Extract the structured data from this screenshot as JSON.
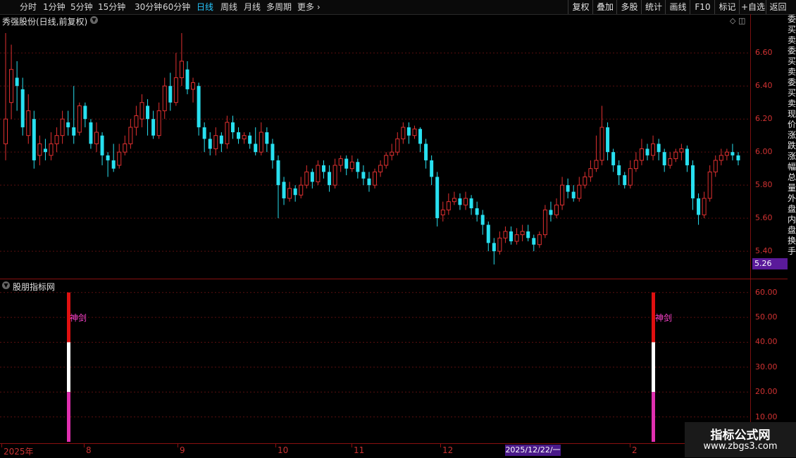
{
  "toolbar": {
    "periods": [
      "分时",
      "1分钟",
      "5分钟",
      "15分钟",
      "30分钟",
      "60分钟",
      "日线",
      "周线",
      "月线",
      "多周期",
      "更多"
    ],
    "active_period": "日线",
    "right_buttons": [
      "复权",
      "叠加",
      "多股",
      "统计",
      "画线",
      "F10",
      "标记",
      "+自选",
      "返回"
    ]
  },
  "main_panel": {
    "title": "秀强股份(日线,前复权)",
    "current_price_label": "5.26",
    "y_ticks": [
      "6.60",
      "6.40",
      "6.20",
      "6.00",
      "5.80",
      "5.60",
      "5.40"
    ]
  },
  "indicator_panel": {
    "title": "股朋指标网",
    "y_ticks": [
      "60.00",
      "50.00",
      "40.00",
      "30.00",
      "20.00",
      "10.00"
    ],
    "signal_label": "神剑",
    "signals": [
      {
        "label": "神剑",
        "value": 60
      },
      {
        "label": "神剑",
        "value": 60
      }
    ]
  },
  "date_axis": {
    "labels": [
      "2025年",
      "8",
      "9",
      "10",
      "11",
      "12",
      "2025/12/22/一",
      "2"
    ],
    "cursor_date": "2025/12/22/一"
  },
  "right_strip_text": "委买卖委买卖委买卖现价涨跌涨幅总量外盘内盘换手",
  "watermark": {
    "title": "指标公式网",
    "url": "www.zbgs3.com"
  },
  "colors": {
    "up": "#e03030",
    "down": "#28e0f0",
    "grid": "#5a0f0f",
    "accent_active": "#27c8ff",
    "signal_text": "#ff44d0"
  },
  "chart_data": {
    "type": "candlestick",
    "y_range": [
      5.26,
      6.75
    ],
    "ohlc_sample_note_hidden": false,
    "candles": [
      [
        6.05,
        6.2,
        6.72,
        5.95
      ],
      [
        6.3,
        6.5,
        6.65,
        6.2
      ],
      [
        6.45,
        6.4,
        6.55,
        6.25
      ],
      [
        6.38,
        6.15,
        6.45,
        6.1
      ],
      [
        6.1,
        6.25,
        6.35,
        6.05
      ],
      [
        6.2,
        5.95,
        6.25,
        5.9
      ],
      [
        5.98,
        6.05,
        6.1,
        5.92
      ],
      [
        6.02,
        6.0,
        6.08,
        5.95
      ],
      [
        5.98,
        6.05,
        6.12,
        5.95
      ],
      [
        6.05,
        6.1,
        6.15,
        6.0
      ],
      [
        6.1,
        6.2,
        6.25,
        6.05
      ],
      [
        6.18,
        6.15,
        6.25,
        6.1
      ],
      [
        6.15,
        6.1,
        6.4,
        6.05
      ],
      [
        6.12,
        6.28,
        6.3,
        6.1
      ],
      [
        6.28,
        6.2,
        6.3,
        6.15
      ],
      [
        6.18,
        6.05,
        6.2,
        6.02
      ],
      [
        6.05,
        6.12,
        6.18,
        6.0
      ],
      [
        6.1,
        5.98,
        6.12,
        5.92
      ],
      [
        5.98,
        5.95,
        6.0,
        5.85
      ],
      [
        5.95,
        5.9,
        6.05,
        5.88
      ],
      [
        5.92,
        6.0,
        6.05,
        5.9
      ],
      [
        6.0,
        6.05,
        6.1,
        5.98
      ],
      [
        6.05,
        6.15,
        6.2,
        6.02
      ],
      [
        6.15,
        6.22,
        6.28,
        6.1
      ],
      [
        6.2,
        6.3,
        6.35,
        6.15
      ],
      [
        6.28,
        6.2,
        6.32,
        6.1
      ],
      [
        6.2,
        6.1,
        6.25,
        6.08
      ],
      [
        6.1,
        6.25,
        6.3,
        6.08
      ],
      [
        6.25,
        6.4,
        6.45,
        6.2
      ],
      [
        6.4,
        6.3,
        6.48,
        6.25
      ],
      [
        6.3,
        6.45,
        6.6,
        6.28
      ],
      [
        6.45,
        6.55,
        6.72,
        6.4
      ],
      [
        6.5,
        6.38,
        6.55,
        6.35
      ],
      [
        6.38,
        6.42,
        6.45,
        6.3
      ],
      [
        6.4,
        6.15,
        6.42,
        6.1
      ],
      [
        6.15,
        6.08,
        6.18,
        6.0
      ],
      [
        6.08,
        6.02,
        6.12,
        5.98
      ],
      [
        6.02,
        6.1,
        6.15,
        5.98
      ],
      [
        6.1,
        6.05,
        6.12,
        6.0
      ],
      [
        6.05,
        6.18,
        6.22,
        6.02
      ],
      [
        6.18,
        6.12,
        6.22,
        6.08
      ],
      [
        6.12,
        6.08,
        6.15,
        6.05
      ],
      [
        6.08,
        6.1,
        6.12,
        6.05
      ],
      [
        6.1,
        6.05,
        6.12,
        6.02
      ],
      [
        6.05,
        6.0,
        6.15,
        5.98
      ],
      [
        6.0,
        6.12,
        6.18,
        5.98
      ],
      [
        6.12,
        6.05,
        6.15,
        6.0
      ],
      [
        6.05,
        5.95,
        6.08,
        5.9
      ],
      [
        5.95,
        5.8,
        5.98,
        5.6
      ],
      [
        5.82,
        5.72,
        5.85,
        5.68
      ],
      [
        5.72,
        5.78,
        5.82,
        5.7
      ],
      [
        5.78,
        5.74,
        5.8,
        5.7
      ],
      [
        5.74,
        5.8,
        5.85,
        5.72
      ],
      [
        5.8,
        5.88,
        5.92,
        5.78
      ],
      [
        5.88,
        5.82,
        5.9,
        5.78
      ],
      [
        5.82,
        5.92,
        5.95,
        5.8
      ],
      [
        5.92,
        5.88,
        5.95,
        5.84
      ],
      [
        5.88,
        5.8,
        5.92,
        5.76
      ],
      [
        5.8,
        5.92,
        5.96,
        5.78
      ],
      [
        5.92,
        5.96,
        5.98,
        5.88
      ],
      [
        5.96,
        5.9,
        5.98,
        5.86
      ],
      [
        5.9,
        5.94,
        5.98,
        5.88
      ],
      [
        5.94,
        5.88,
        5.96,
        5.84
      ],
      [
        5.88,
        5.84,
        5.92,
        5.8
      ],
      [
        5.84,
        5.8,
        5.88,
        5.76
      ],
      [
        5.8,
        5.88,
        5.9,
        5.78
      ],
      [
        5.88,
        5.92,
        5.95,
        5.85
      ],
      [
        5.92,
        5.98,
        6.0,
        5.9
      ],
      [
        5.98,
        6.0,
        6.05,
        5.95
      ],
      [
        6.0,
        6.08,
        6.12,
        5.98
      ],
      [
        6.08,
        6.15,
        6.18,
        6.05
      ],
      [
        6.15,
        6.1,
        6.18,
        6.05
      ],
      [
        6.1,
        6.14,
        6.16,
        6.08
      ],
      [
        6.14,
        6.05,
        6.15,
        6.0
      ],
      [
        6.05,
        5.95,
        6.08,
        5.9
      ],
      [
        5.95,
        5.85,
        5.98,
        5.8
      ],
      [
        5.85,
        5.6,
        5.88,
        5.55
      ],
      [
        5.62,
        5.65,
        5.7,
        5.58
      ],
      [
        5.65,
        5.7,
        5.75,
        5.62
      ],
      [
        5.7,
        5.72,
        5.76,
        5.68
      ],
      [
        5.72,
        5.68,
        5.75,
        5.65
      ],
      [
        5.68,
        5.72,
        5.76,
        5.65
      ],
      [
        5.72,
        5.66,
        5.74,
        5.62
      ],
      [
        5.66,
        5.62,
        5.7,
        5.58
      ],
      [
        5.62,
        5.56,
        5.65,
        5.5
      ],
      [
        5.56,
        5.45,
        5.58,
        5.4
      ],
      [
        5.45,
        5.4,
        5.48,
        5.32
      ],
      [
        5.4,
        5.48,
        5.52,
        5.38
      ],
      [
        5.48,
        5.52,
        5.55,
        5.45
      ],
      [
        5.52,
        5.46,
        5.55,
        5.44
      ],
      [
        5.46,
        5.5,
        5.54,
        5.44
      ],
      [
        5.5,
        5.52,
        5.56,
        5.46
      ],
      [
        5.52,
        5.48,
        5.56,
        5.46
      ],
      [
        5.48,
        5.44,
        5.5,
        5.4
      ],
      [
        5.44,
        5.5,
        5.52,
        5.42
      ],
      [
        5.5,
        5.65,
        5.68,
        5.48
      ],
      [
        5.65,
        5.62,
        5.7,
        5.58
      ],
      [
        5.62,
        5.68,
        5.72,
        5.6
      ],
      [
        5.68,
        5.8,
        5.85,
        5.65
      ],
      [
        5.8,
        5.76,
        5.84,
        5.72
      ],
      [
        5.76,
        5.72,
        5.8,
        5.7
      ],
      [
        5.72,
        5.8,
        5.85,
        5.7
      ],
      [
        5.8,
        5.85,
        5.88,
        5.78
      ],
      [
        5.85,
        5.9,
        5.95,
        5.82
      ],
      [
        5.9,
        5.95,
        6.1,
        5.88
      ],
      [
        5.95,
        6.15,
        6.28,
        5.92
      ],
      [
        6.15,
        6.0,
        6.18,
        5.95
      ],
      [
        6.0,
        5.92,
        6.02,
        5.88
      ],
      [
        5.92,
        5.86,
        5.95,
        5.8
      ],
      [
        5.86,
        5.8,
        5.88,
        5.78
      ],
      [
        5.8,
        5.9,
        5.95,
        5.78
      ],
      [
        5.9,
        5.95,
        6.0,
        5.88
      ],
      [
        5.95,
        6.02,
        6.08,
        5.92
      ],
      [
        6.02,
        5.98,
        6.05,
        5.95
      ],
      [
        5.98,
        6.05,
        6.1,
        5.95
      ],
      [
        6.05,
        6.0,
        6.08,
        5.95
      ],
      [
        6.0,
        5.92,
        6.02,
        5.88
      ],
      [
        5.92,
        5.96,
        6.0,
        5.9
      ],
      [
        5.96,
        6.0,
        6.02,
        5.94
      ],
      [
        6.0,
        6.02,
        6.05,
        5.95
      ],
      [
        6.02,
        5.92,
        6.04,
        5.88
      ],
      [
        5.92,
        5.72,
        5.95,
        5.65
      ],
      [
        5.72,
        5.62,
        5.75,
        5.56
      ],
      [
        5.62,
        5.72,
        5.76,
        5.6
      ],
      [
        5.72,
        5.88,
        5.92,
        5.7
      ],
      [
        5.88,
        5.95,
        5.98,
        5.85
      ],
      [
        5.95,
        5.98,
        6.02,
        5.92
      ],
      [
        5.98,
        6.0,
        6.02,
        5.95
      ],
      [
        6.0,
        5.98,
        6.05,
        5.95
      ],
      [
        5.98,
        5.95,
        6.0,
        5.92
      ]
    ]
  }
}
